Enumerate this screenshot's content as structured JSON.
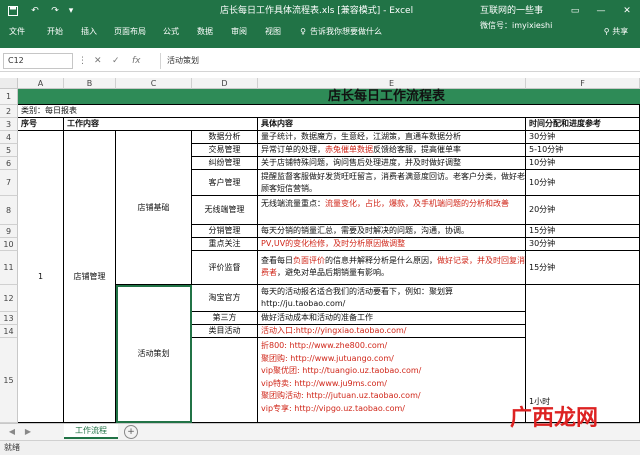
{
  "window": {
    "title": "店长每日工作具体流程表.xls [兼容模式] - Excel",
    "right_text": "互联网的一些事",
    "account": "微信号：imyixieshi",
    "ribbon_collapse": "▭",
    "minimize": "—",
    "maximize": "☐",
    "close": "✕"
  },
  "quick_access": {
    "save_icon": "save-icon",
    "undo": "↶",
    "redo": "↷"
  },
  "ribbon": {
    "tabs": [
      "文件",
      "开始",
      "插入",
      "页面布局",
      "公式",
      "数据",
      "审阅",
      "视图"
    ],
    "tell_me": "告诉我你想要做什么",
    "share": "共享"
  },
  "formula_bar": {
    "name_box": "C12",
    "cancel": "✕",
    "enter": "✓",
    "fx": "fx",
    "content": "活动策划"
  },
  "columns": [
    "A",
    "B",
    "C",
    "D",
    "E",
    "F"
  ],
  "rows": [
    "1",
    "2",
    "3",
    "4",
    "5",
    "6",
    "7",
    "8",
    "9",
    "10",
    "11",
    "12",
    "13",
    "14",
    "15"
  ],
  "sheet": {
    "title": "店长每日工作流程表",
    "category": "类别：每日报表",
    "headers": {
      "seq": "序号",
      "content": "工作内容",
      "detail": "具体内容",
      "time": "时间分配和进度参考"
    },
    "seq_value": "1",
    "main_item": "店铺管理",
    "group_a": "店铺基础",
    "group_b": "活动策划",
    "rows_a": [
      {
        "item": "数据分析",
        "detail": "量子统计，数据魔方，生意经，江湖策，直通车数据分析",
        "time": "30分钟"
      },
      {
        "item": "交易管理",
        "detail_pre": "异常订单的处理，",
        "detail_red": "赤兔催单数据",
        "detail_post": "反馈给客服，提高催单率",
        "time": "5-10分钟"
      },
      {
        "item": "纠纷管理",
        "detail": "关于店铺特殊问题，询问售后处理进度，并及时做好调整",
        "time": "10分钟"
      },
      {
        "item": "客户管理",
        "detail": "提醒监督客服做好发货旺旺留言，消费者满意度回访。老客户分类，做好老顾客短信营销。",
        "time": "10分钟"
      },
      {
        "item": "无线端管理",
        "detail_pre": "无线端流量重点：",
        "detail_red": "流量变化，占比，爆款，及手机端问题的分析和改善",
        "time": "20分钟"
      },
      {
        "item": "分销管理",
        "detail": "每天分销的销量汇总，需要及时解决的问题，沟通，协调。",
        "time": "15分钟"
      },
      {
        "item": "重点关注",
        "detail_red": "PV,UV的变化检修，及时分析原因做调整",
        "time": "30分钟"
      },
      {
        "item": "评价监督",
        "detail_pre": "查看每日",
        "detail_red": "负面评价",
        "detail_mid": "的信息并解释分析是什么原因，",
        "detail_red2": "做好记录，并及时回复消费者",
        "detail_post": "，避免对单品后期销量有影响。",
        "time": "15分钟"
      }
    ],
    "rows_b": [
      {
        "item": "淘宝官方",
        "detail1": "每天的活动报名适合我们的活动要看下，例如：聚划算",
        "detail2": "http://ju.taobao.com/"
      },
      {
        "item": "第三方",
        "detail": "做好活动成本和活动的准备工作"
      },
      {
        "item": "类目活动",
        "detail_red": "活动入口:http://yingxiao.taobao.com/"
      }
    ],
    "links": [
      "折800: http://www.zhe800.com/",
      "聚团购: http://www.jutuango.com/",
      "vip聚优团: http://tuangio.uz.taobao.com/",
      "vip特卖: http://www.ju9ms.com/",
      "聚团购活动: http://jutuan.uz.taobao.com/",
      "vip专享: http://vipgo.uz.taobao.com/"
    ],
    "time_b": "1小时"
  },
  "tabs_bar": {
    "prev": "◀",
    "next": "▶",
    "sheet_name": "工作流程",
    "add": "+"
  },
  "status": {
    "text": "就绪"
  },
  "watermark": "广西龙网",
  "colors": {
    "excel_green": "#217346",
    "title_band": "#2e8b57",
    "red_text": "#d0271a"
  }
}
